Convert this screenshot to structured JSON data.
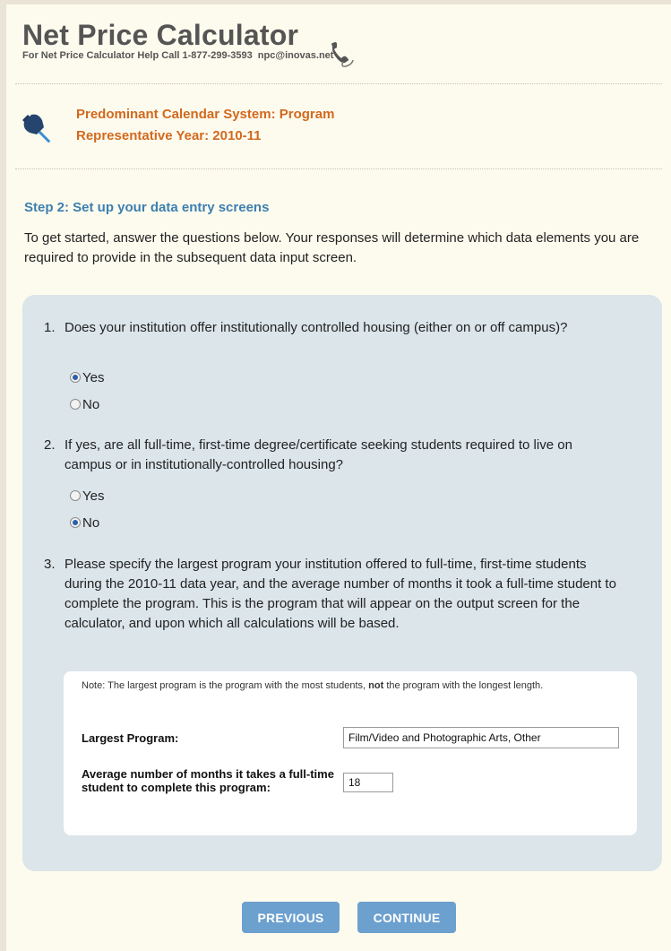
{
  "header": {
    "title": "Net Price Calculator",
    "help_text": "For Net Price Calculator Help Call 1-877-299-3593",
    "help_email": "npc@inovas.net"
  },
  "calendar": {
    "system": "Predominant Calendar System: Program",
    "year": "Representative Year: 2010-11"
  },
  "step": {
    "title": "Step 2: Set up your data entry screens",
    "intro": "To get started, answer the questions below. Your responses will determine which data elements you are required to provide in the subsequent data input screen."
  },
  "questions": [
    {
      "number": "1.",
      "text": "Does your institution offer institutionally controlled housing (either on or off campus)?",
      "options": [
        {
          "label": "Yes",
          "selected": true
        },
        {
          "label": "No",
          "selected": false
        }
      ]
    },
    {
      "number": "2.",
      "text": "If yes, are all full-time, first-time degree/certificate seeking students required to live on campus or in institutionally-controlled housing?",
      "options": [
        {
          "label": "Yes",
          "selected": false
        },
        {
          "label": "No",
          "selected": true
        }
      ]
    },
    {
      "number": "3.",
      "text": "Please specify the largest program your institution offered to full-time, first-time students during the 2010-11 data year, and the average number of months it took a full-time student to complete the program. This is the program that will appear on the output screen for the calculator, and upon which all calculations will be based."
    }
  ],
  "program": {
    "note_prefix": "Note: The largest program is the program with the most students, ",
    "note_bold": "not",
    "note_suffix": " the program with the longest length.",
    "largest_label": "Largest Program:",
    "largest_value": "Film/Video and Photographic Arts, Other",
    "months_label": "Average number of months it takes a full-time student to complete this program:",
    "months_value": "18"
  },
  "buttons": {
    "previous": "PREVIOUS",
    "continue": "CONTINUE"
  },
  "colors": {
    "page_bg": "#fdfbee",
    "panel_bg": "#dbe5ea",
    "accent_orange": "#d2691e",
    "step_blue": "#3d7fb0",
    "button_blue": "#6ca0cf"
  },
  "icons": {
    "phone": "phone-icon",
    "pin": "pushpin-icon"
  }
}
